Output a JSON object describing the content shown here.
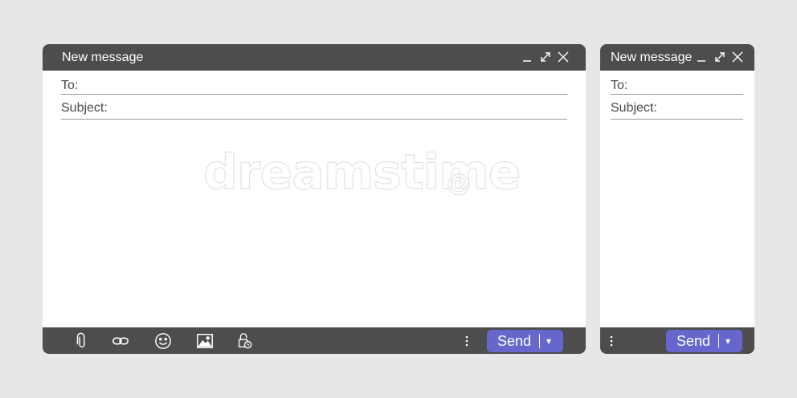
{
  "windows": [
    {
      "title": "New message",
      "to_label": "To:",
      "subject_label": "Subject:",
      "send_label": "Send",
      "send_dropdown_icon": "▾",
      "toolbar_icons": [
        "paperclip-icon",
        "link-icon",
        "emoji-icon",
        "image-icon",
        "lock-clock-icon"
      ]
    },
    {
      "title": "New message",
      "to_label": "To:",
      "subject_label": "Subject:",
      "send_label": "Send",
      "send_dropdown_icon": "▾"
    }
  ],
  "watermark": "dreamstime",
  "colors": {
    "background": "#e6e7e8",
    "bar": "#4d4d4d",
    "send": "#6666cc",
    "text": "#4a4a4a"
  }
}
